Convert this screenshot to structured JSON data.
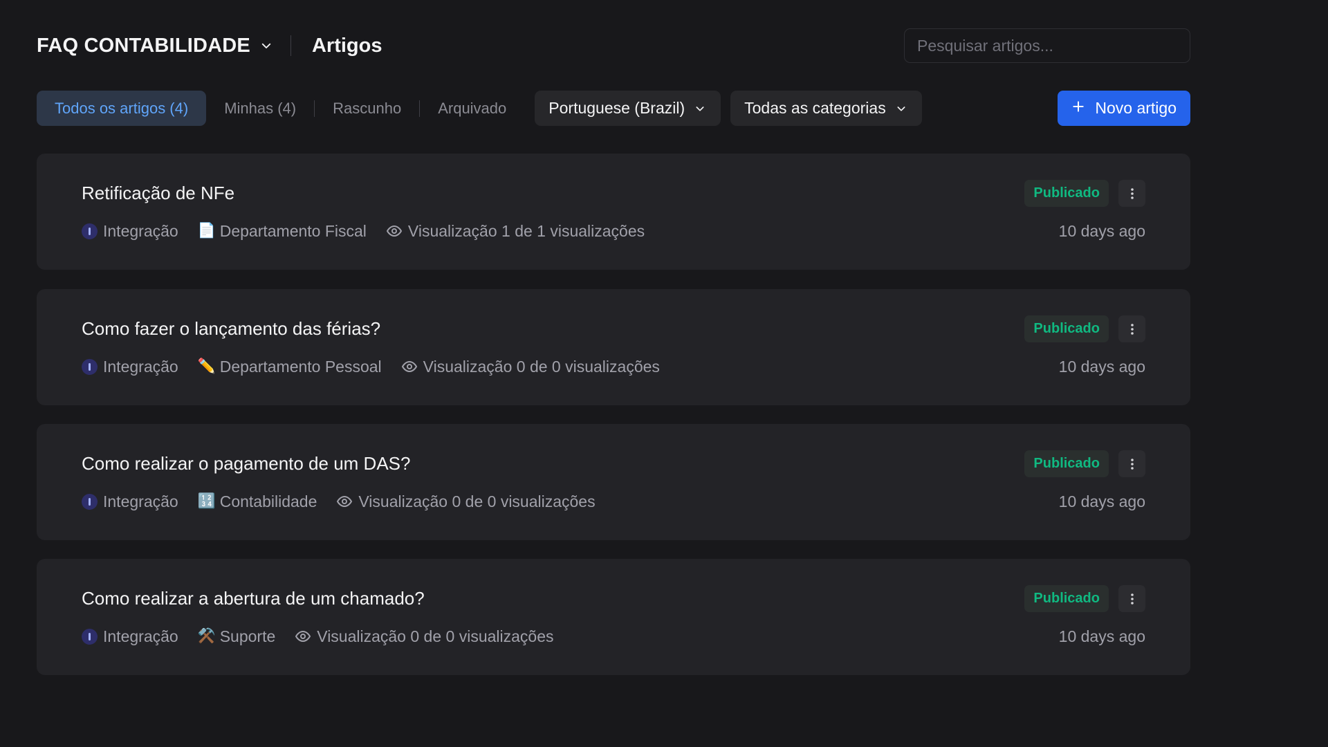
{
  "header": {
    "portal_name": "FAQ CONTABILIDADE",
    "page_title": "Artigos",
    "search_placeholder": "Pesquisar artigos..."
  },
  "toolbar": {
    "tabs": [
      {
        "label": "Todos os artigos (4)",
        "active": true
      },
      {
        "label": "Minhas (4)",
        "active": false
      },
      {
        "label": "Rascunho",
        "active": false
      },
      {
        "label": "Arquivado",
        "active": false
      }
    ],
    "language_filter": "Portuguese (Brazil)",
    "category_filter": "Todas as categorias",
    "new_article_label": "Novo artigo"
  },
  "articles": [
    {
      "title": "Retificação de NFe",
      "author": "Integração",
      "category_icon": "📄",
      "category": "Departamento Fiscal",
      "views": "Visualização 1 de 1 visualizações",
      "status": "Publicado",
      "updated": "10 days ago"
    },
    {
      "title": "Como fazer o lançamento das férias?",
      "author": "Integração",
      "category_icon": "✏️",
      "category": "Departamento Pessoal",
      "views": "Visualização 0 de 0 visualizações",
      "status": "Publicado",
      "updated": "10 days ago"
    },
    {
      "title": "Como realizar o pagamento de um DAS?",
      "author": "Integração",
      "category_icon": "🔢",
      "category": "Contabilidade",
      "views": "Visualização 0 de 0 visualizações",
      "status": "Publicado",
      "updated": "10 days ago"
    },
    {
      "title": "Como realizar a abertura de um chamado?",
      "author": "Integração",
      "category_icon": "⚒️",
      "category": "Suporte",
      "views": "Visualização 0 de 0 visualizações",
      "status": "Publicado",
      "updated": "10 days ago"
    }
  ],
  "colors": {
    "background": "#18181b",
    "card": "#232327",
    "accent": "#2563eb",
    "status_published": "#10b981",
    "active_tab_text": "#60a5fa"
  }
}
